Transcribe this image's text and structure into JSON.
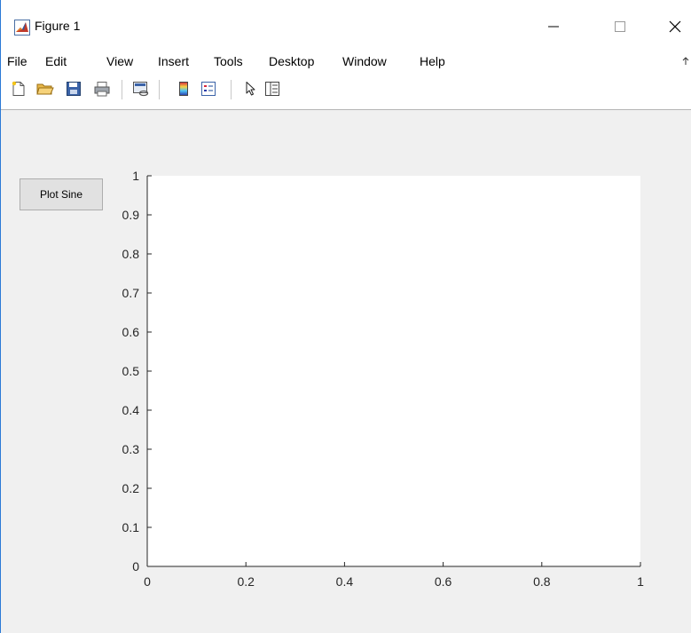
{
  "window": {
    "title": "Figure 1",
    "controls": {
      "minimize": "—",
      "maximize": "☐",
      "close": "✕"
    }
  },
  "menu": {
    "items": [
      "File",
      "Edit",
      "View",
      "Insert",
      "Tools",
      "Desktop",
      "Window",
      "Help"
    ]
  },
  "toolbar": {
    "icons": [
      "new-figure-icon",
      "open-file-icon",
      "save-icon",
      "print-icon",
      "link-plot-icon",
      "insert-colorbar-icon",
      "insert-legend-icon",
      "edit-plot-icon",
      "property-inspector-icon"
    ]
  },
  "figure": {
    "button_label": "Plot Sine"
  },
  "chart_data": {
    "type": "line",
    "title": "",
    "xlabel": "",
    "ylabel": "",
    "xlim": [
      0,
      1
    ],
    "ylim": [
      0,
      1
    ],
    "xticks": [
      0,
      0.2,
      0.4,
      0.6,
      0.8,
      1
    ],
    "yticks": [
      0,
      0.1,
      0.2,
      0.3,
      0.4,
      0.5,
      0.6,
      0.7,
      0.8,
      0.9,
      1
    ],
    "xtick_labels": [
      "0",
      "0.2",
      "0.4",
      "0.6",
      "0.8",
      "1"
    ],
    "ytick_labels": [
      "0",
      "0.1",
      "0.2",
      "0.3",
      "0.4",
      "0.5",
      "0.6",
      "0.7",
      "0.8",
      "0.9",
      "1"
    ],
    "series": [],
    "grid": false,
    "colors": {
      "axes_bg": "#ffffff",
      "axis_line": "#262626",
      "figure_bg": "#f0f0f0"
    }
  }
}
